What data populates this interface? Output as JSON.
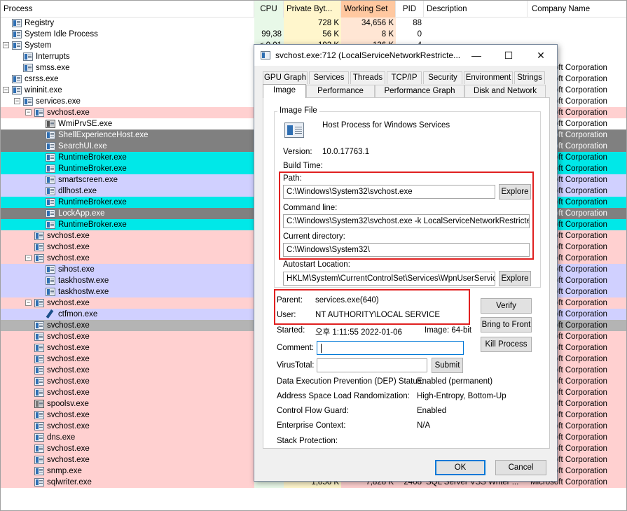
{
  "columns": [
    "Process",
    "CPU",
    "Private Byt...",
    "Working Set",
    "PID",
    "Description",
    "Company Name"
  ],
  "processes": [
    {
      "name": "Registry",
      "depth": 0,
      "toggle": "",
      "bg": "#ffffff",
      "cpu": "",
      "priv": "728 K",
      "ws": "34,656 K",
      "pid": "88",
      "desc": "",
      "company": ""
    },
    {
      "name": "System Idle Process",
      "depth": 0,
      "toggle": "",
      "bg": "#ffffff",
      "cpu": "99,38",
      "priv": "56 K",
      "ws": "8 K",
      "pid": "0",
      "desc": "",
      "company": ""
    },
    {
      "name": "System",
      "depth": 0,
      "toggle": "−",
      "bg": "#ffffff",
      "cpu": "< 0.01",
      "priv": "192 K",
      "ws": "136 K",
      "pid": "4",
      "desc": "",
      "company": ""
    },
    {
      "name": "Interrupts",
      "depth": 1,
      "toggle": "",
      "bg": "#ffffff",
      "cpu": "",
      "priv": "",
      "ws": "",
      "pid": "",
      "desc": "",
      "company": ""
    },
    {
      "name": "smss.exe",
      "depth": 1,
      "toggle": "",
      "bg": "#ffffff",
      "cpu": "",
      "priv": "",
      "ws": "",
      "pid": "",
      "desc": "",
      "company": "Microsoft Corporation"
    },
    {
      "name": "csrss.exe",
      "depth": 0,
      "toggle": "",
      "bg": "#ffffff",
      "cpu": "",
      "priv": "",
      "ws": "",
      "pid": "",
      "desc": "",
      "company": "Microsoft Corporation"
    },
    {
      "name": "wininit.exe",
      "depth": 0,
      "toggle": "−",
      "bg": "#ffffff",
      "cpu": "",
      "priv": "",
      "ws": "",
      "pid": "",
      "desc": "",
      "company": "Microsoft Corporation"
    },
    {
      "name": "services.exe",
      "depth": 1,
      "toggle": "−",
      "bg": "#ffffff",
      "cpu": "",
      "priv": "",
      "ws": "",
      "pid": "",
      "desc": "",
      "company": "Microsoft Corporation"
    },
    {
      "name": "svchost.exe",
      "depth": 2,
      "toggle": "−",
      "bg": "#ffd0d0",
      "cpu": "",
      "priv": "",
      "ws": "",
      "pid": "",
      "desc": "",
      "company": "Microsoft Corporation"
    },
    {
      "name": "WmiPrvSE.exe",
      "depth": 3,
      "toggle": "",
      "bg": "#ffffff",
      "icon": "wmi",
      "cpu": "",
      "priv": "",
      "ws": "",
      "pid": "",
      "desc": "",
      "company": "Microsoft Corporation"
    },
    {
      "name": "ShellExperienceHost.exe",
      "depth": 3,
      "toggle": "",
      "bg": "#808080",
      "cpu": "",
      "priv": "",
      "ws": "",
      "pid": "",
      "desc": "",
      "company": "Microsoft Corporation"
    },
    {
      "name": "SearchUI.exe",
      "depth": 3,
      "toggle": "",
      "bg": "#808080",
      "cpu": "",
      "priv": "",
      "ws": "",
      "pid": "",
      "desc": "",
      "company": "Microsoft Corporation"
    },
    {
      "name": "RuntimeBroker.exe",
      "depth": 3,
      "toggle": "",
      "bg": "#00e8e8",
      "cpu": "",
      "priv": "",
      "ws": "",
      "pid": "",
      "desc": "",
      "company": "Microsoft Corporation"
    },
    {
      "name": "RuntimeBroker.exe",
      "depth": 3,
      "toggle": "",
      "bg": "#00e8e8",
      "cpu": "",
      "priv": "",
      "ws": "",
      "pid": "",
      "desc": "",
      "company": "Microsoft Corporation"
    },
    {
      "name": "smartscreen.exe",
      "depth": 3,
      "toggle": "",
      "bg": "#d0d0ff",
      "cpu": "",
      "priv": "",
      "ws": "",
      "pid": "",
      "desc": "",
      "company": "Microsoft Corporation"
    },
    {
      "name": "dllhost.exe",
      "depth": 3,
      "toggle": "",
      "bg": "#d0d0ff",
      "cpu": "",
      "priv": "",
      "ws": "",
      "pid": "",
      "desc": "",
      "company": "Microsoft Corporation"
    },
    {
      "name": "RuntimeBroker.exe",
      "depth": 3,
      "toggle": "",
      "bg": "#00e8e8",
      "cpu": "",
      "priv": "",
      "ws": "",
      "pid": "",
      "desc": "",
      "company": "Microsoft Corporation"
    },
    {
      "name": "LockApp.exe",
      "depth": 3,
      "toggle": "",
      "bg": "#808080",
      "cpu": "",
      "priv": "",
      "ws": "",
      "pid": "",
      "desc": "",
      "company": "Microsoft Corporation"
    },
    {
      "name": "RuntimeBroker.exe",
      "depth": 3,
      "toggle": "",
      "bg": "#00e8e8",
      "cpu": "",
      "priv": "",
      "ws": "",
      "pid": "",
      "desc": "",
      "company": "Microsoft Corporation"
    },
    {
      "name": "svchost.exe",
      "depth": 2,
      "toggle": "",
      "bg": "#ffd0d0",
      "cpu": "",
      "priv": "",
      "ws": "",
      "pid": "",
      "desc": "",
      "company": "Microsoft Corporation"
    },
    {
      "name": "svchost.exe",
      "depth": 2,
      "toggle": "",
      "bg": "#ffd0d0",
      "cpu": "",
      "priv": "",
      "ws": "",
      "pid": "",
      "desc": "",
      "company": "Microsoft Corporation"
    },
    {
      "name": "svchost.exe",
      "depth": 2,
      "toggle": "−",
      "bg": "#ffd0d0",
      "cpu": "",
      "priv": "",
      "ws": "",
      "pid": "",
      "desc": "",
      "company": "Microsoft Corporation"
    },
    {
      "name": "sihost.exe",
      "depth": 3,
      "toggle": "",
      "bg": "#d0d0ff",
      "cpu": "",
      "priv": "",
      "ws": "",
      "pid": "",
      "desc": "",
      "company": "Microsoft Corporation"
    },
    {
      "name": "taskhostw.exe",
      "depth": 3,
      "toggle": "",
      "bg": "#d0d0ff",
      "cpu": "",
      "priv": "",
      "ws": "",
      "pid": "",
      "desc": "",
      "company": "Microsoft Corporation"
    },
    {
      "name": "taskhostw.exe",
      "depth": 3,
      "toggle": "",
      "bg": "#d0d0ff",
      "cpu": "",
      "priv": "",
      "ws": "",
      "pid": "",
      "desc": "",
      "company": "Microsoft Corporation"
    },
    {
      "name": "svchost.exe",
      "depth": 2,
      "toggle": "−",
      "bg": "#ffd0d0",
      "cpu": "",
      "priv": "",
      "ws": "",
      "pid": "",
      "desc": "",
      "company": "Microsoft Corporation"
    },
    {
      "name": "ctfmon.exe",
      "depth": 3,
      "toggle": "",
      "bg": "#d0d0ff",
      "icon": "pen",
      "cpu": "",
      "priv": "",
      "ws": "",
      "pid": "",
      "desc": "",
      "company": "Microsoft Corporation"
    },
    {
      "name": "svchost.exe",
      "depth": 2,
      "toggle": "",
      "bg": "#b4b4b4",
      "cpu": "",
      "priv": "",
      "ws": "",
      "pid": "",
      "desc": "",
      "company": "Microsoft Corporation"
    },
    {
      "name": "svchost.exe",
      "depth": 2,
      "toggle": "",
      "bg": "#ffd0d0",
      "cpu": "",
      "priv": "",
      "ws": "",
      "pid": "",
      "desc": "",
      "company": "Microsoft Corporation"
    },
    {
      "name": "svchost.exe",
      "depth": 2,
      "toggle": "",
      "bg": "#ffd0d0",
      "cpu": "",
      "priv": "",
      "ws": "",
      "pid": "",
      "desc": "",
      "company": "Microsoft Corporation"
    },
    {
      "name": "svchost.exe",
      "depth": 2,
      "toggle": "",
      "bg": "#ffd0d0",
      "cpu": "",
      "priv": "",
      "ws": "",
      "pid": "",
      "desc": "",
      "company": "Microsoft Corporation"
    },
    {
      "name": "svchost.exe",
      "depth": 2,
      "toggle": "",
      "bg": "#ffd0d0",
      "cpu": "",
      "priv": "",
      "ws": "",
      "pid": "",
      "desc": "",
      "company": "Microsoft Corporation"
    },
    {
      "name": "svchost.exe",
      "depth": 2,
      "toggle": "",
      "bg": "#ffd0d0",
      "cpu": "",
      "priv": "",
      "ws": "",
      "pid": "",
      "desc": "",
      "company": "Microsoft Corporation"
    },
    {
      "name": "svchost.exe",
      "depth": 2,
      "toggle": "",
      "bg": "#ffd0d0",
      "cpu": "",
      "priv": "",
      "ws": "",
      "pid": "",
      "desc": "",
      "company": "Microsoft Corporation"
    },
    {
      "name": "spoolsv.exe",
      "depth": 2,
      "toggle": "",
      "bg": "#ffd0d0",
      "icon": "prn",
      "cpu": "",
      "priv": "",
      "ws": "",
      "pid": "",
      "desc": "",
      "company": "Microsoft Corporation"
    },
    {
      "name": "svchost.exe",
      "depth": 2,
      "toggle": "",
      "bg": "#ffd0d0",
      "cpu": "",
      "priv": "",
      "ws": "",
      "pid": "",
      "desc": "",
      "company": "Microsoft Corporation"
    },
    {
      "name": "svchost.exe",
      "depth": 2,
      "toggle": "",
      "bg": "#ffd0d0",
      "cpu": "",
      "priv": "",
      "ws": "",
      "pid": "",
      "desc": "",
      "company": "Microsoft Corporation"
    },
    {
      "name": "dns.exe",
      "depth": 2,
      "toggle": "",
      "bg": "#ffd0d0",
      "cpu": "",
      "priv": "",
      "ws": "",
      "pid": "",
      "desc": "",
      "company": "Microsoft Corporation"
    },
    {
      "name": "svchost.exe",
      "depth": 2,
      "toggle": "",
      "bg": "#ffd0d0",
      "cpu": "",
      "priv": "",
      "ws": "",
      "pid": "",
      "desc": "",
      "company": "Microsoft Corporation"
    },
    {
      "name": "svchost.exe",
      "depth": 2,
      "toggle": "",
      "bg": "#ffd0d0",
      "cpu": "",
      "priv": "2,472 K",
      "ws": "6,828 K",
      "pid": "2388",
      "desc": "Host Process for Windo...",
      "company": "Microsoft Corporation"
    },
    {
      "name": "snmp.exe",
      "depth": 2,
      "toggle": "",
      "bg": "#ffd0d0",
      "cpu": "",
      "priv": "4,092 K",
      "ws": "9,788 K",
      "pid": "2344",
      "desc": "SNMP Service",
      "company": "Microsoft Corporation"
    },
    {
      "name": "sqlwriter.exe",
      "depth": 2,
      "toggle": "",
      "bg": "#ffd0d0",
      "cpu": "",
      "priv": "1,856 K",
      "ws": "7,828 K",
      "pid": "2408",
      "desc": "SQL Server VSS Writer ...",
      "company": "Microsoft Corporation"
    }
  ],
  "dialog": {
    "title": "svchost.exe:712 (LocalServiceNetworkRestricte...",
    "minimize": "—",
    "maximize": "☐",
    "close": "✕",
    "tabs_top": [
      "GPU Graph",
      "Services",
      "Threads",
      "TCP/IP",
      "Security",
      "Environment",
      "Strings"
    ],
    "tabs_bottom": [
      "Image",
      "Performance",
      "Performance Graph",
      "Disk and Network"
    ],
    "image_file_label": "Image File",
    "file_description": "Host Process for Windows Services",
    "version_label": "Version:",
    "version_value": "10.0.17763.1",
    "build_time_label": "Build Time:",
    "path_label": "Path:",
    "path_value": "C:\\Windows\\System32\\svchost.exe",
    "explore": "Explore",
    "cmdline_label": "Command line:",
    "cmdline_value": "C:\\Windows\\System32\\svchost.exe -k LocalServiceNetworkRestricted",
    "curdir_label": "Current directory:",
    "curdir_value": "C:\\Windows\\System32\\",
    "autostart_label": "Autostart Location:",
    "autostart_value": "HKLM\\System\\CurrentControlSet\\Services\\WpnUserService",
    "parent_label": "Parent:",
    "parent_value": "services.exe(640)",
    "user_label": "User:",
    "user_value": "NT AUTHORITY\\LOCAL SERVICE",
    "started_label": "Started:",
    "started_value": "오후 1:11:55  2022-01-06",
    "image_bits": "Image: 64-bit",
    "verify": "Verify",
    "bring_to_front": "Bring to Front",
    "kill_process": "Kill Process",
    "comment_label": "Comment:",
    "comment_value": "",
    "virustotal_label": "VirusTotal:",
    "virustotal_value": "",
    "submit": "Submit",
    "dep_label": "Data Execution Prevention (DEP) Status:",
    "dep_value": "Enabled (permanent)",
    "aslr_label": "Address Space Load Randomization:",
    "aslr_value": "High-Entropy, Bottom-Up",
    "cfg_label": "Control Flow Guard:",
    "cfg_value": "Enabled",
    "enterprise_label": "Enterprise Context:",
    "enterprise_value": "N/A",
    "stack_label": "Stack Protection:",
    "stack_value": "",
    "ok": "OK",
    "cancel": "Cancel"
  },
  "colors": {
    "cpu_col": "#e8f8e8",
    "private_col": "#fff6cc",
    "working_col": "#ffc8a0",
    "highlight_red": "#e02020",
    "accent_blue": "#0078d7"
  }
}
